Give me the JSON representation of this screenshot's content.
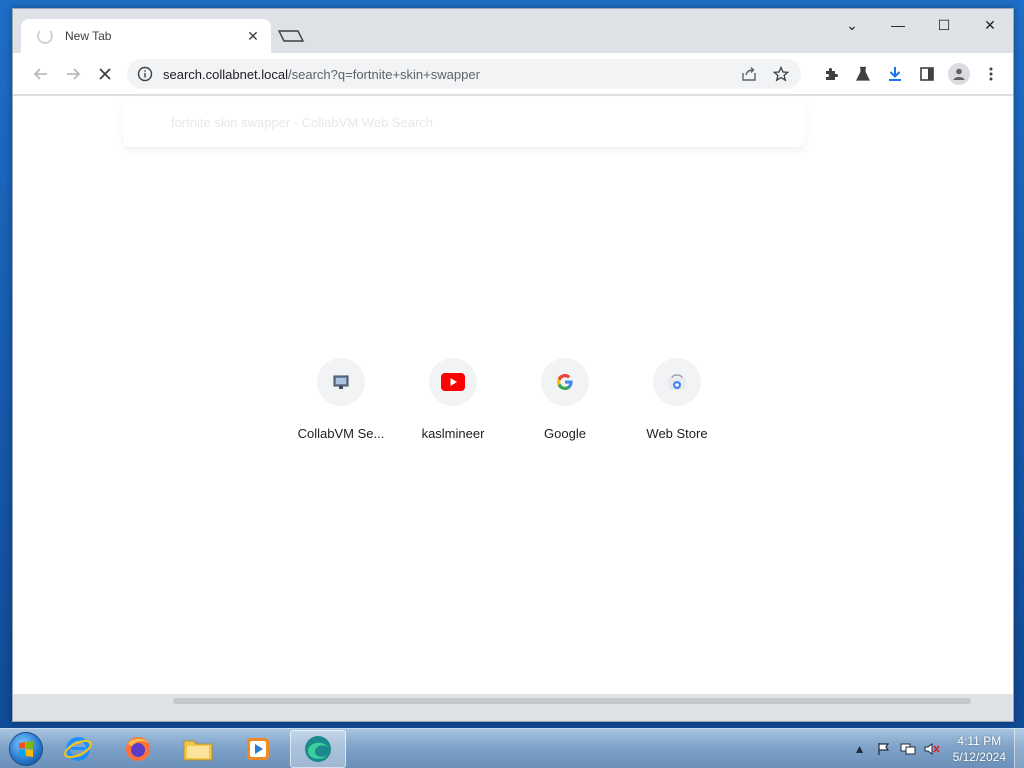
{
  "browser": {
    "tab": {
      "title": "New Tab",
      "close_glyph": "✕"
    },
    "window_controls": {
      "dropdown": "⌄",
      "minimize": "—",
      "maximize": "☐",
      "close": "✕"
    },
    "omnibox": {
      "host": "search.collabnet.local",
      "path": "/search?q=fortnite+skin+swapper"
    },
    "suggestion_ghost": "fortnite skin swapper - CollabVM Web Search",
    "shortcuts": [
      {
        "label": "CollabVM Se...",
        "icon": "collabvm-icon"
      },
      {
        "label": "kaslmineer",
        "icon": "youtube-icon"
      },
      {
        "label": "Google",
        "icon": "google-icon"
      },
      {
        "label": "Web Store",
        "icon": "webstore-icon"
      }
    ]
  },
  "taskbar": {
    "apps": [
      {
        "name": "internet-explorer-icon"
      },
      {
        "name": "firefox-icon"
      },
      {
        "name": "file-explorer-icon"
      },
      {
        "name": "media-player-icon"
      },
      {
        "name": "edge-icon",
        "active": true
      }
    ],
    "clock": {
      "time": "4:11 PM",
      "date": "5/12/2024"
    }
  },
  "colors": {
    "accent_download": "#1a73e8",
    "youtube_red": "#ff0000"
  }
}
